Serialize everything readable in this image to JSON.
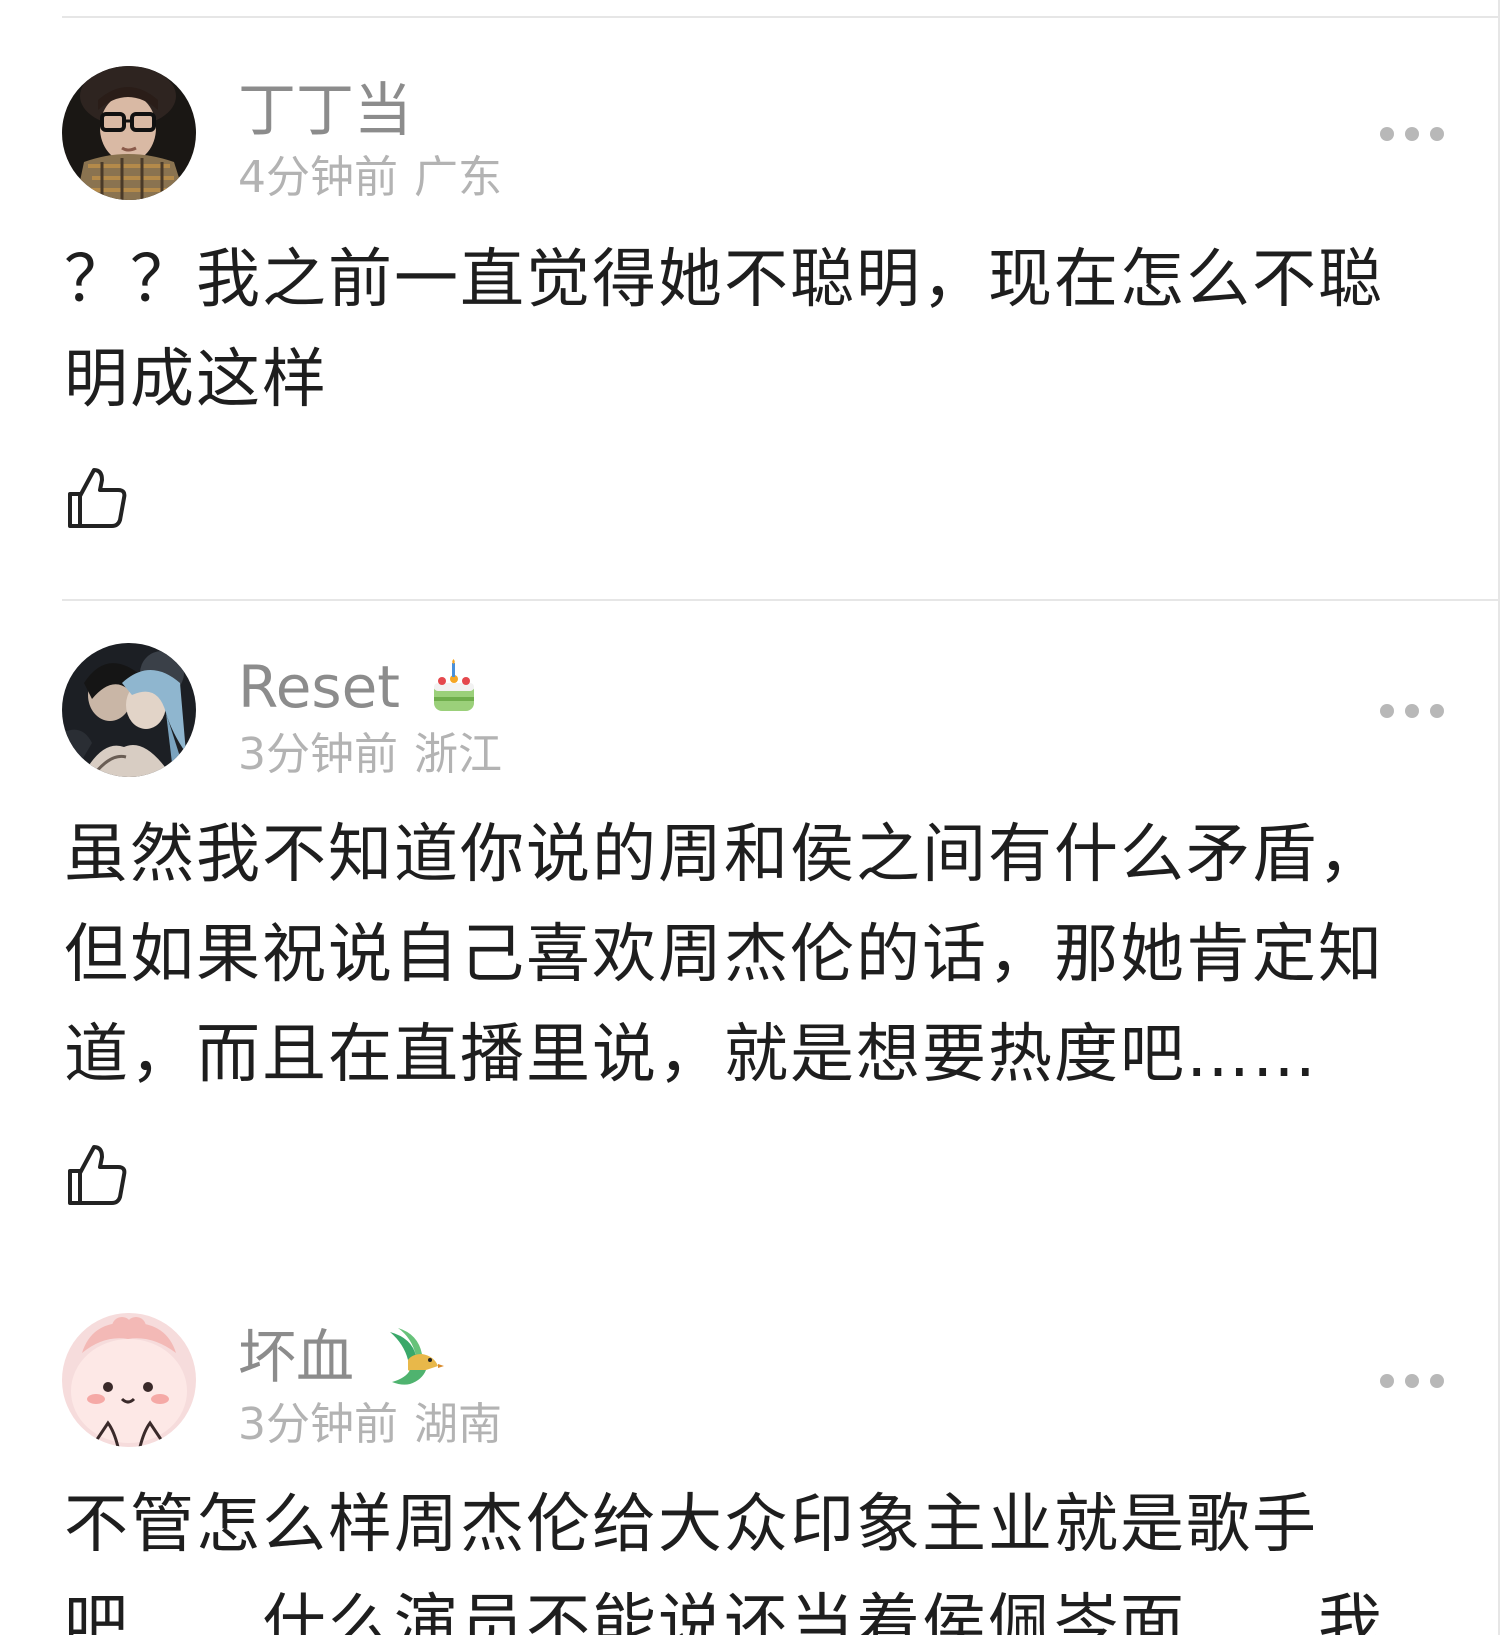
{
  "comments": [
    {
      "username": "丁丁当",
      "time": "4分钟前",
      "location": "广东",
      "text": "？？我之前一直觉得她不聪明，现在怎么不聪明成这样",
      "avatar_icon": "person-avatar-glasses-scarf",
      "badge_icon": null
    },
    {
      "username": "Reset",
      "time": "3分钟前",
      "location": "浙江",
      "text": "虽然我不知道你说的周和侯之间有什么矛盾，但如果祝说自己喜欢周杰伦的话，那她肯定知道，而且在直播里说，就是想要热度吧……",
      "avatar_icon": "anime-characters-avatar",
      "badge_icon": "birthday-cake-icon"
    },
    {
      "username": "坏血",
      "time": "3分钟前",
      "location": "湖南",
      "text": "不管怎么样周杰伦给大众印象主业就是歌手吧……什么演员不能说还当着侯佩岑面……我",
      "avatar_icon": "pink-cartoon-avatar",
      "badge_icon": "green-bird-icon"
    }
  ],
  "colors": {
    "username": "#8c8c8c",
    "meta": "#b3b3b3",
    "text": "#1e1e1e",
    "divider": "#e6e6e6",
    "more_dots": "#b8b8b8"
  }
}
